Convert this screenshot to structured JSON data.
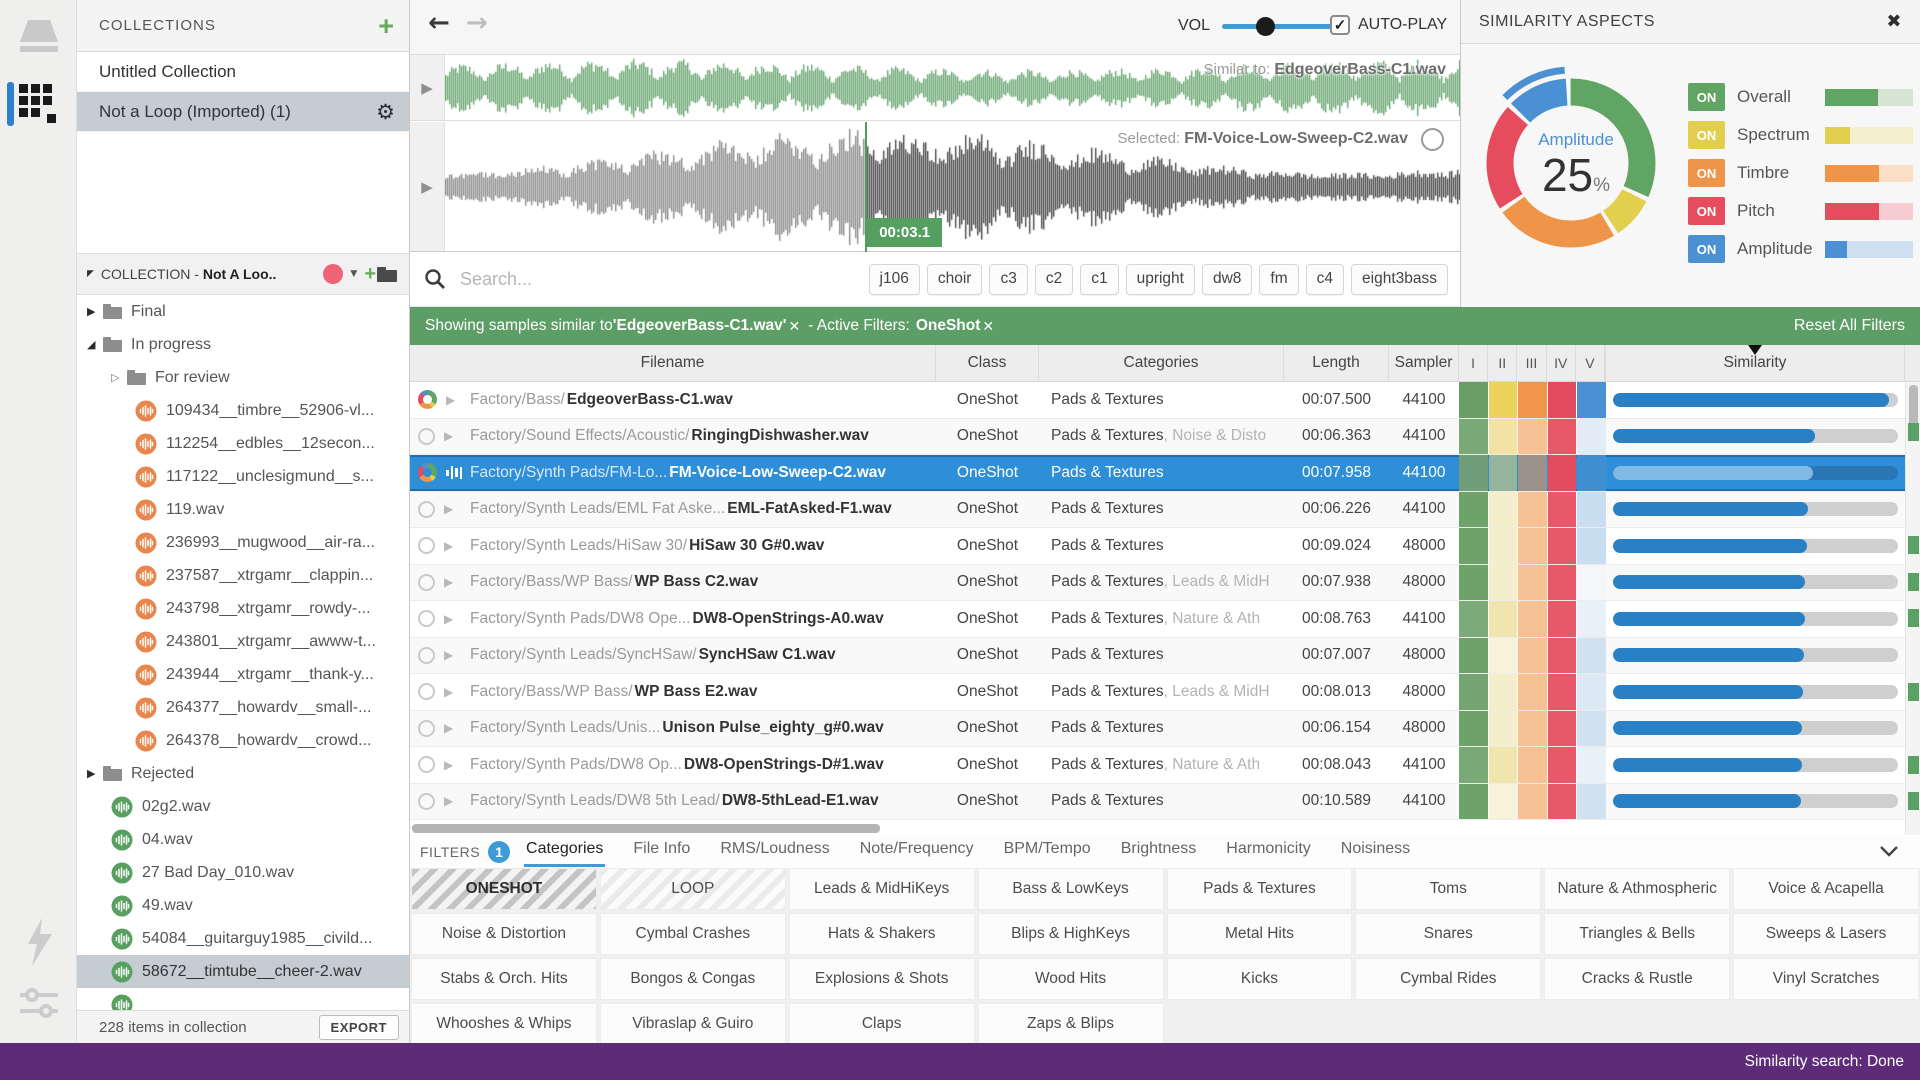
{
  "colors": {
    "accent_green": "#5d9e66",
    "selection_blue": "#2e8ed8",
    "sim_bar_blue": "#2980c4",
    "purple_statusbar": "#5e2b78",
    "sidebar_selected": "#c6cdd2",
    "orange_file_icon": "#e8864d",
    "green_file_icon": "#57a05f",
    "waveform_similar": "#68a570",
    "waveform_selected": "#4a4a4a",
    "waveform_played": "#8b8b8b"
  },
  "collections_panel": {
    "header": "COLLECTIONS",
    "add_label": "+",
    "items": [
      {
        "label": "Untitled Collection",
        "selected": false
      },
      {
        "label": "Not a Loop (Imported) (1)",
        "selected": true
      }
    ]
  },
  "collection_tree": {
    "header_prefix": "COLLECTION - ",
    "header_name": "Not A Loo..",
    "nodes": [
      {
        "type": "folder",
        "depth": 0,
        "label": "Final",
        "state": "collapsed"
      },
      {
        "type": "folder",
        "depth": 0,
        "label": "In progress",
        "state": "expanded"
      },
      {
        "type": "folder",
        "depth": 1,
        "label": "For review",
        "state": "outline"
      },
      {
        "type": "file",
        "depth": 1,
        "label": "109434__timbre__52906-vl...",
        "color": "orange"
      },
      {
        "type": "file",
        "depth": 1,
        "label": "112254__edbles__12secon...",
        "color": "orange"
      },
      {
        "type": "file",
        "depth": 1,
        "label": "117122__unclesigmund__s...",
        "color": "orange"
      },
      {
        "type": "file",
        "depth": 1,
        "label": "119.wav",
        "color": "orange"
      },
      {
        "type": "file",
        "depth": 1,
        "label": "236993__mugwood__air-ra...",
        "color": "orange"
      },
      {
        "type": "file",
        "depth": 1,
        "label": "237587__xtrgamr__clappin...",
        "color": "orange"
      },
      {
        "type": "file",
        "depth": 1,
        "label": "243798__xtrgamr__rowdy-...",
        "color": "orange"
      },
      {
        "type": "file",
        "depth": 1,
        "label": "243801__xtrgamr__awww-t...",
        "color": "orange"
      },
      {
        "type": "file",
        "depth": 1,
        "label": "243944__xtrgamr__thank-y...",
        "color": "orange"
      },
      {
        "type": "file",
        "depth": 1,
        "label": "264377__howardv__small-...",
        "color": "orange"
      },
      {
        "type": "file",
        "depth": 1,
        "label": "264378__howardv__crowd...",
        "color": "orange"
      },
      {
        "type": "folder",
        "depth": 0,
        "label": "Rejected",
        "state": "collapsed"
      },
      {
        "type": "file",
        "depth": 0,
        "label": "02g2.wav",
        "color": "green"
      },
      {
        "type": "file",
        "depth": 0,
        "label": "04.wav",
        "color": "green"
      },
      {
        "type": "file",
        "depth": 0,
        "label": "27 Bad Day_010.wav",
        "color": "green"
      },
      {
        "type": "file",
        "depth": 0,
        "label": "49.wav",
        "color": "green"
      },
      {
        "type": "file",
        "depth": 0,
        "label": "54084__guitarguy1985__civild...",
        "color": "green"
      },
      {
        "type": "file",
        "depth": 0,
        "label": "58672__timtube__cheer-2.wav",
        "color": "green",
        "selected": true
      },
      {
        "type": "file",
        "depth": 0,
        "label": "",
        "color": "green"
      }
    ]
  },
  "sidebar_footer": {
    "count_label": "228 items in collection",
    "export_label": "EXPORT"
  },
  "topbar": {
    "vol_label": "VOL",
    "vol_frac": 0.38,
    "autoplay_label": "AUTO-PLAY",
    "autoplay_checked": true,
    "check_glyph": "✓"
  },
  "waveforms": {
    "similar": {
      "prefix": "Similar to: ",
      "filename": "EdgeoverBass-C1.wav"
    },
    "selected": {
      "prefix": "Selected: ",
      "filename": "FM-Voice-Low-Sweep-C2.wav",
      "position_label": "00:03.1",
      "position_frac": 0.414
    }
  },
  "search": {
    "placeholder": "Search...",
    "tags": [
      "j106",
      "choir",
      "c3",
      "c2",
      "c1",
      "upright",
      "dw8",
      "fm",
      "c4",
      "eight3bass"
    ]
  },
  "filter_bar": {
    "prefix": "Showing samples similar to ",
    "similar_file": "'EdgeoverBass-C1.wav'",
    "remove_glyph": "✕",
    "mid": " - Active Filters:  ",
    "active_filter": "OneShot",
    "reset_label": "Reset All Filters"
  },
  "table": {
    "columns": {
      "filename": "Filename",
      "class": "Class",
      "categories": "Categories",
      "length": "Length",
      "samplerate": "Sampler",
      "heat": [
        "I",
        "II",
        "III",
        "IV",
        "V"
      ],
      "similarity": "Similarity"
    },
    "scroll_marks": [
      78,
      191,
      228,
      264,
      338,
      411,
      447
    ],
    "rows": [
      {
        "path": "Factory/Bass/ ",
        "file": "EdgeoverBass-C1.wav",
        "cls": "OneShot",
        "cat": "Pads & Textures",
        "cat2": "",
        "len": "00:07.500",
        "rate": "44100",
        "heat": [
          "#6a9e64",
          "#ecd35b",
          "#f0954a",
          "#e54b60",
          "#4a90d2"
        ],
        "sim": 0.97,
        "ring": true
      },
      {
        "path": "Factory/Sound Effects/Acoustic/ ",
        "file": "RingingDishwasher.wav",
        "cls": "OneShot",
        "cat": "Pads & Textures",
        "cat2": ", Noise & Disto",
        "len": "00:06.363",
        "rate": "44100",
        "heat": [
          "#7aa876",
          "#f2e3a4",
          "#f6c193",
          "#e8586b",
          "#e2ecf6"
        ],
        "sim": 0.71
      },
      {
        "path": "Factory/Synth Pads/FM-Lo...",
        "file": "FM-Voice-Low-Sweep-C2.wav",
        "cls": "OneShot",
        "cat": "Pads & Textures",
        "cat2": "",
        "len": "00:07.958",
        "rate": "44100",
        "heat": [
          "#6f9e79",
          "#94b49b",
          "#9b9389",
          "#e34b5e",
          "#3f8fd1"
        ],
        "sim": 0.7,
        "selected": true,
        "ring": true,
        "eq": true
      },
      {
        "path": "Factory/Synth Leads/EML Fat Aske...",
        "file": "EML-FatAsked-F1.wav",
        "cls": "OneShot",
        "cat": "Pads & Textures",
        "cat2": "",
        "len": "00:06.226",
        "rate": "44100",
        "heat": [
          "#6fa269",
          "#f5eecb",
          "#f6c193",
          "#e8586b",
          "#cadef1"
        ],
        "sim": 0.685
      },
      {
        "path": "Factory/Synth Leads/HiSaw 30/ ",
        "file": "HiSaw 30 G#0.wav",
        "cls": "OneShot",
        "cat": "Pads & Textures",
        "cat2": "",
        "len": "00:09.024",
        "rate": "48000",
        "heat": [
          "#6fa269",
          "#f5eecb",
          "#f6c193",
          "#e8586b",
          "#cadef1"
        ],
        "sim": 0.68
      },
      {
        "path": "Factory/Bass/WP Bass/ ",
        "file": "WP Bass C2.wav",
        "cls": "OneShot",
        "cat": "Pads & Textures",
        "cat2": ", Leads & MidH",
        "len": "00:07.938",
        "rate": "48000",
        "heat": [
          "#6fa269",
          "#f5eecb",
          "#f6c193",
          "#e8586b",
          "#f4f6f9"
        ],
        "sim": 0.675
      },
      {
        "path": "Factory/Synth Pads/DW8 Ope... ",
        "file": "DW8-OpenStrings-A0.wav",
        "cls": "OneShot",
        "cat": "Pads & Textures",
        "cat2": ", Nature & Ath",
        "len": "00:08.763",
        "rate": "44100",
        "heat": [
          "#7cab79",
          "#f0e5ac",
          "#f6c193",
          "#e8586b",
          "#e8f0f8"
        ],
        "sim": 0.672
      },
      {
        "path": "Factory/Synth Leads/SyncHSaw/ ",
        "file": "SyncHSaw C1.wav",
        "cls": "OneShot",
        "cat": "Pads & Textures",
        "cat2": "",
        "len": "00:07.007",
        "rate": "48000",
        "heat": [
          "#6fa269",
          "#f7f2d9",
          "#f6c193",
          "#e8586b",
          "#cfe2f2"
        ],
        "sim": 0.67
      },
      {
        "path": "Factory/Bass/WP Bass/ ",
        "file": "WP Bass E2.wav",
        "cls": "OneShot",
        "cat": "Pads & Textures",
        "cat2": ", Leads & MidH",
        "len": "00:08.013",
        "rate": "48000",
        "heat": [
          "#75a671",
          "#f5eecb",
          "#f6c193",
          "#e8586b",
          "#dce9f5"
        ],
        "sim": 0.668
      },
      {
        "path": "Factory/Synth Leads/Unis...",
        "file": "Unison Pulse_eighty_g#0.wav",
        "cls": "OneShot",
        "cat": "Pads & Textures",
        "cat2": "",
        "len": "00:06.154",
        "rate": "48000",
        "heat": [
          "#6fa269",
          "#f5eecb",
          "#f6c193",
          "#e8586b",
          "#cfe2f2"
        ],
        "sim": 0.664
      },
      {
        "path": "Factory/Synth Pads/DW8 Op... ",
        "file": "DW8-OpenStrings-D#1.wav",
        "cls": "OneShot",
        "cat": "Pads & Textures",
        "cat2": ", Nature & Ath",
        "len": "00:08.043",
        "rate": "44100",
        "heat": [
          "#7aa876",
          "#f0e5ac",
          "#f6c193",
          "#e8586b",
          "#e8f0f8"
        ],
        "sim": 0.662
      },
      {
        "path": "Factory/Synth Leads/DW8 5th Lead/ ",
        "file": "DW8-5thLead-E1.wav",
        "cls": "OneShot",
        "cat": "Pads & Textures",
        "cat2": "",
        "len": "00:10.589",
        "rate": "44100",
        "heat": [
          "#6fa269",
          "#f7f2d9",
          "#f6c193",
          "#e8586b",
          "#cfe2f2"
        ],
        "sim": 0.66
      }
    ]
  },
  "filters_section": {
    "filters_label": "FILTERS",
    "badge": "1",
    "tabs": [
      {
        "label": "Categories",
        "active": true
      },
      {
        "label": "File Info"
      },
      {
        "label": "RMS/Loudness"
      },
      {
        "label": "Note/Frequency"
      },
      {
        "label": "BPM/Tempo"
      },
      {
        "label": "Brightness"
      },
      {
        "label": "Harmonicity"
      },
      {
        "label": "Noisiness"
      }
    ],
    "categories_grid": [
      [
        {
          "label": "ONESHOT",
          "style": "sel"
        },
        {
          "label": "LOOP",
          "style": "alt"
        },
        {
          "label": "Leads & MidHiKeys"
        },
        {
          "label": "Bass & LowKeys"
        },
        {
          "label": "Pads & Textures"
        },
        {
          "label": "Toms"
        },
        {
          "label": "Nature & Athmospheric"
        },
        {
          "label": "Voice & Acapella"
        }
      ],
      [
        {
          "label": "Noise & Distortion"
        },
        {
          "label": "Cymbal Crashes"
        },
        {
          "label": "Hats & Shakers"
        },
        {
          "label": "Blips & HighKeys"
        },
        {
          "label": "Metal Hits"
        },
        {
          "label": "Snares"
        },
        {
          "label": "Triangles & Bells"
        },
        {
          "label": "Sweeps & Lasers"
        }
      ],
      [
        {
          "label": "Stabs & Orch. Hits"
        },
        {
          "label": "Bongos & Congas"
        },
        {
          "label": "Explosions & Shots"
        },
        {
          "label": "Wood Hits"
        },
        {
          "label": "Kicks"
        },
        {
          "label": "Cymbal Rides"
        },
        {
          "label": "Cracks & Rustle"
        },
        {
          "label": "Vinyl Scratches"
        }
      ],
      [
        {
          "label": "Whooshes & Whips"
        },
        {
          "label": "Vibraslap & Guiro"
        },
        {
          "label": "Claps"
        },
        {
          "label": "Zaps & Blips"
        },
        {
          "label": "",
          "style": "empty"
        },
        {
          "label": "",
          "style": "empty"
        },
        {
          "label": "",
          "style": "empty"
        },
        {
          "label": "",
          "style": "empty"
        }
      ]
    ]
  },
  "similarity_aspects": {
    "title": "SIMILARITY ASPECTS",
    "close_glyph": "✖",
    "center_label": "Amplitude",
    "center_value": "25",
    "center_unit": "%",
    "aspects": [
      {
        "name": "Overall",
        "on_label": "ON",
        "color": "#61a564",
        "track": "#d6e4d4",
        "weight": 0.6,
        "donut": 0.325
      },
      {
        "name": "Spectrum",
        "on_label": "ON",
        "color": "#e3cf4e",
        "track": "#f5efd0",
        "weight": 0.28,
        "donut": 0.09
      },
      {
        "name": "Timbre",
        "on_label": "ON",
        "color": "#ef9549",
        "track": "#fadfc6",
        "weight": 0.61,
        "donut": 0.245
      },
      {
        "name": "Pitch",
        "on_label": "ON",
        "color": "#e64c5e",
        "track": "#f7cdd3",
        "weight": 0.61,
        "donut": 0.215
      },
      {
        "name": "Amplitude",
        "on_label": "ON",
        "color": "#4a90d2",
        "track": "#cfdfef",
        "weight": 0.25,
        "donut": 0.125,
        "highlighted": true
      }
    ]
  },
  "status_bar": {
    "text": "Similarity search: Done"
  }
}
